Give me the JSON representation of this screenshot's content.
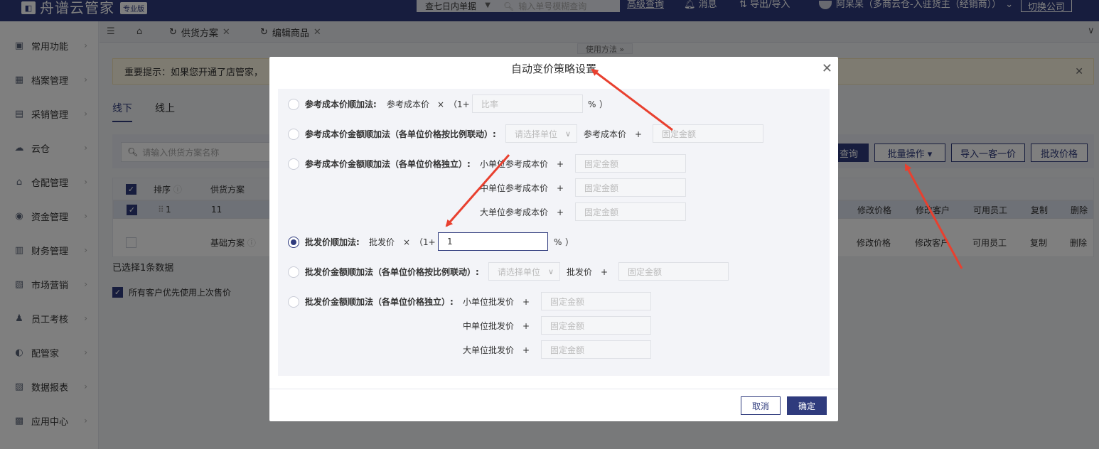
{
  "app": {
    "name": "舟谱云管家",
    "edition": "专业版"
  },
  "topbar": {
    "range": "查七日内单据",
    "search_placeholder": "输入单号模糊查询",
    "advanced": "高级查询",
    "messages": "消息",
    "export": "导出/导入",
    "user": "阿呆呆（多商云仓-入驻货主（经销商））",
    "switch": "切换公司"
  },
  "sidebar": {
    "items": [
      {
        "label": "常用功能",
        "icon": "common-icon"
      },
      {
        "label": "档案管理",
        "icon": "archive-icon"
      },
      {
        "label": "采销管理",
        "icon": "purchase-icon"
      },
      {
        "label": "云仓",
        "icon": "cloud-icon"
      },
      {
        "label": "仓配管理",
        "icon": "warehouse-icon"
      },
      {
        "label": "资金管理",
        "icon": "fund-icon"
      },
      {
        "label": "财务管理",
        "icon": "finance-icon"
      },
      {
        "label": "市场营销",
        "icon": "marketing-icon"
      },
      {
        "label": "员工考核",
        "icon": "staff-icon"
      },
      {
        "label": "配管家",
        "icon": "delivery-icon"
      },
      {
        "label": "数据报表",
        "icon": "report-icon"
      },
      {
        "label": "应用中心",
        "icon": "apps-icon"
      }
    ]
  },
  "tabs": [
    {
      "label": "供货方案"
    },
    {
      "label": "编辑商品"
    }
  ],
  "usage": "使用方法 »",
  "notice": "重要提示：如果您开通了店管家，",
  "subtabs": [
    "线下",
    "线上"
  ],
  "filter": {
    "placeholder": "请输入供货方案名称",
    "query": "查询",
    "batch": "批量操作 ▾",
    "import": "导入一客一价",
    "batch_price": "批改价格"
  },
  "table": {
    "headers": {
      "order": "排序",
      "plan": "供货方案"
    },
    "rows": [
      {
        "order": "1",
        "plan": "11",
        "checked": true
      },
      {
        "order": "",
        "plan": "基础方案",
        "checked": false
      }
    ],
    "actions": [
      "修改价格",
      "修改客户",
      "可用员工",
      "复制",
      "删除"
    ]
  },
  "selected_count": "已选择1条数据",
  "pref": "所有客户优先使用上次售价",
  "dialog": {
    "title": "自动变价策略设置",
    "r1": {
      "label": "参考成本价顺加法:",
      "base": "参考成本价",
      "times": "×",
      "paren": "（1+",
      "ph": "比率",
      "pct": "%",
      "close": "）"
    },
    "r2": {
      "label": "参考成本价金额顺加法（各单位价格按比例联动）:",
      "unit_ph": "请选择单位",
      "base": "参考成本价",
      "plus": "+",
      "ph": "固定金额"
    },
    "r3": {
      "label": "参考成本价金额顺加法（各单位价格独立）:",
      "small": "小单位参考成本价",
      "mid": "中单位参考成本价",
      "large": "大单位参考成本价",
      "plus": "+",
      "ph": "固定金额"
    },
    "r4": {
      "label": "批发价顺加法:",
      "base": "批发价",
      "times": "×",
      "paren": "（1+",
      "value": "1",
      "pct": "%",
      "close": "）"
    },
    "r5": {
      "label": "批发价金额顺加法（各单位价格按比例联动）:",
      "unit_ph": "请选择单位",
      "base": "批发价",
      "plus": "+",
      "ph": "固定金额"
    },
    "r6": {
      "label": "批发价金额顺加法（各单位价格独立）:",
      "small": "小单位批发价",
      "mid": "中单位批发价",
      "large": "大单位批发价",
      "plus": "+",
      "ph": "固定金额"
    },
    "cancel": "取消",
    "ok": "确定"
  }
}
